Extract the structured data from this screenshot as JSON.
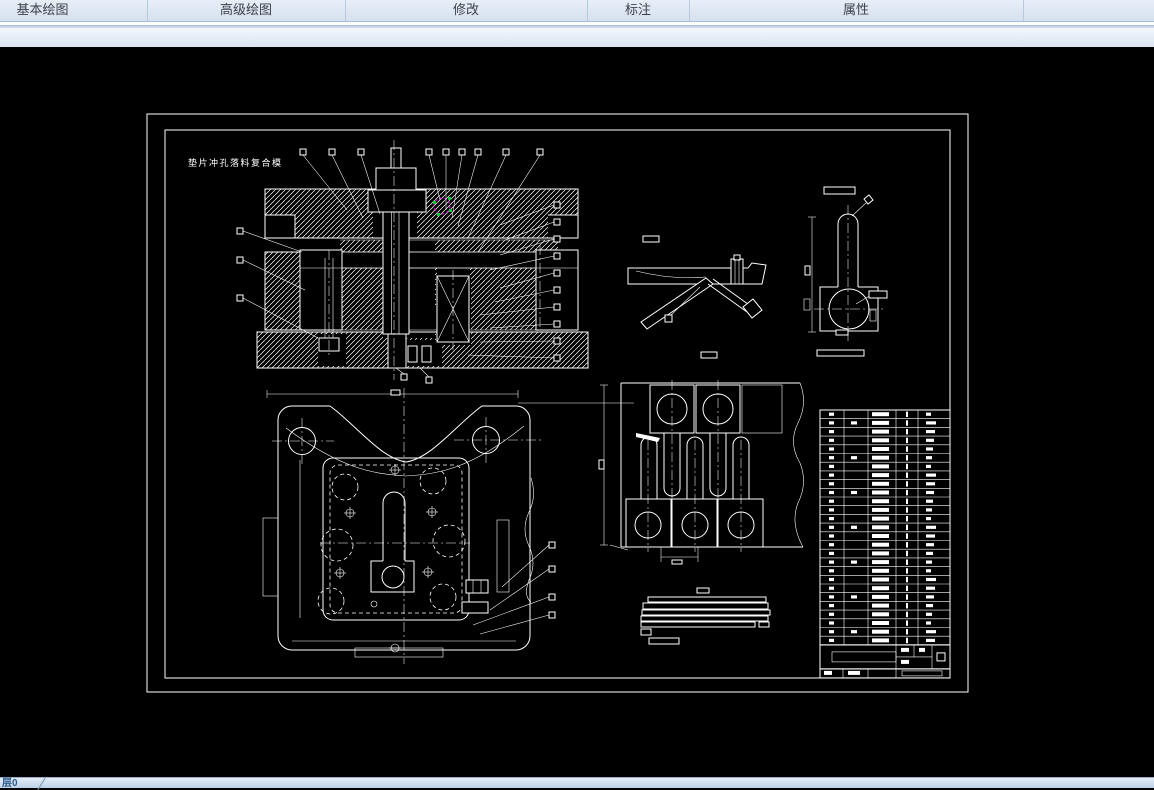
{
  "ribbon": {
    "tabs": [
      {
        "label": "基本绘图"
      },
      {
        "label": "高级绘图"
      },
      {
        "label": "修改"
      },
      {
        "label": "标注"
      },
      {
        "label": "属性"
      }
    ]
  },
  "drawing": {
    "title": "垫片冲孔落料复合模"
  },
  "bom_table": {
    "rows": 27,
    "columns": 5
  },
  "statusbar": {
    "layer_label": "层0"
  },
  "colors": {
    "canvas_bg": "#000000",
    "line": "#ffffff",
    "selection_magenta": "#ff00ff",
    "selection_green": "#00cc33",
    "ribbon_text": "#3c414b",
    "status_text": "#2a5a8c"
  }
}
